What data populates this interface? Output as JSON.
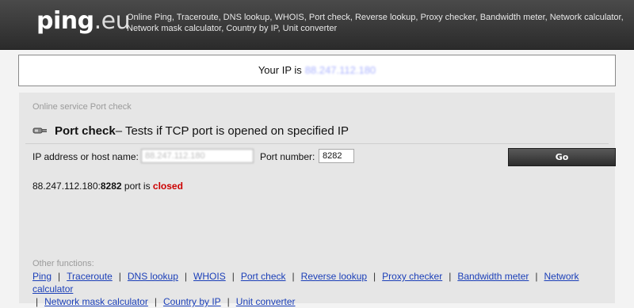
{
  "header": {
    "logo_main": "ping",
    "logo_domain": ".eu",
    "links_line1": "Online Ping, Traceroute, DNS lookup, WHOIS, Port check, Reverse lookup, Proxy checker, Bandwidth meter, Network calculator,",
    "links_line2": "Network mask calculator, Country by IP, Unit converter"
  },
  "ip_bar": {
    "label": "Your IP is",
    "value": "88.247.112.180"
  },
  "panel": {
    "breadcrumb": "Online service Port check",
    "title_bold": "Port check",
    "title_rest": " – Tests if TCP port is opened on specified IP",
    "form": {
      "host_label": "IP address or host name:",
      "host_value": "88.247.112.180",
      "port_label": "Port number:",
      "port_value": "8282",
      "go_label": "Go"
    },
    "result": {
      "ip": "88.247.112.180:",
      "port": "8282",
      "middle": " port is ",
      "status": "closed"
    },
    "other": {
      "title": "Other functions:",
      "links": [
        "Ping",
        "Traceroute",
        "DNS lookup",
        "WHOIS",
        "Port check",
        "Reverse lookup",
        "Proxy checker",
        "Bandwidth meter",
        "Network calculator",
        "Network mask calculator",
        "Country by IP",
        "Unit converter"
      ]
    }
  }
}
